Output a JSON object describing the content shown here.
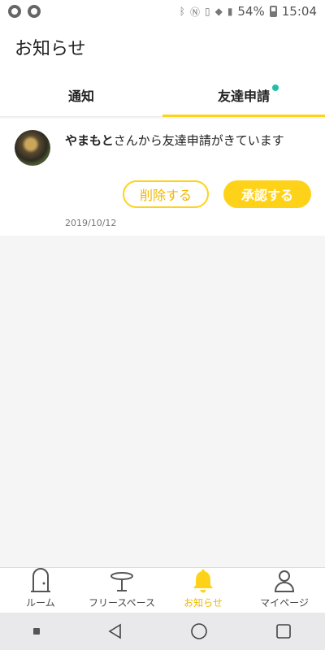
{
  "status_bar": {
    "battery": "54%",
    "time": "15:04"
  },
  "header": {
    "title": "お知らせ"
  },
  "tabs": [
    {
      "label": "通知",
      "active": false
    },
    {
      "label": "友達申請",
      "active": true,
      "has_dot": true
    }
  ],
  "notification": {
    "name": "やまもと",
    "message": "さんから友達申請がきています",
    "delete_label": "削除する",
    "approve_label": "承認する",
    "date": "2019/10/12"
  },
  "bottom_nav": {
    "items": [
      {
        "label": "ルーム",
        "icon": "door-icon",
        "active": false
      },
      {
        "label": "フリースペース",
        "icon": "table-icon",
        "active": false
      },
      {
        "label": "お知らせ",
        "icon": "bell-icon",
        "active": true
      },
      {
        "label": "マイページ",
        "icon": "person-icon",
        "active": false
      }
    ]
  },
  "colors": {
    "accent": "#ffd21a",
    "accent_text": "#f0b800",
    "dot": "#1fbfa8"
  }
}
